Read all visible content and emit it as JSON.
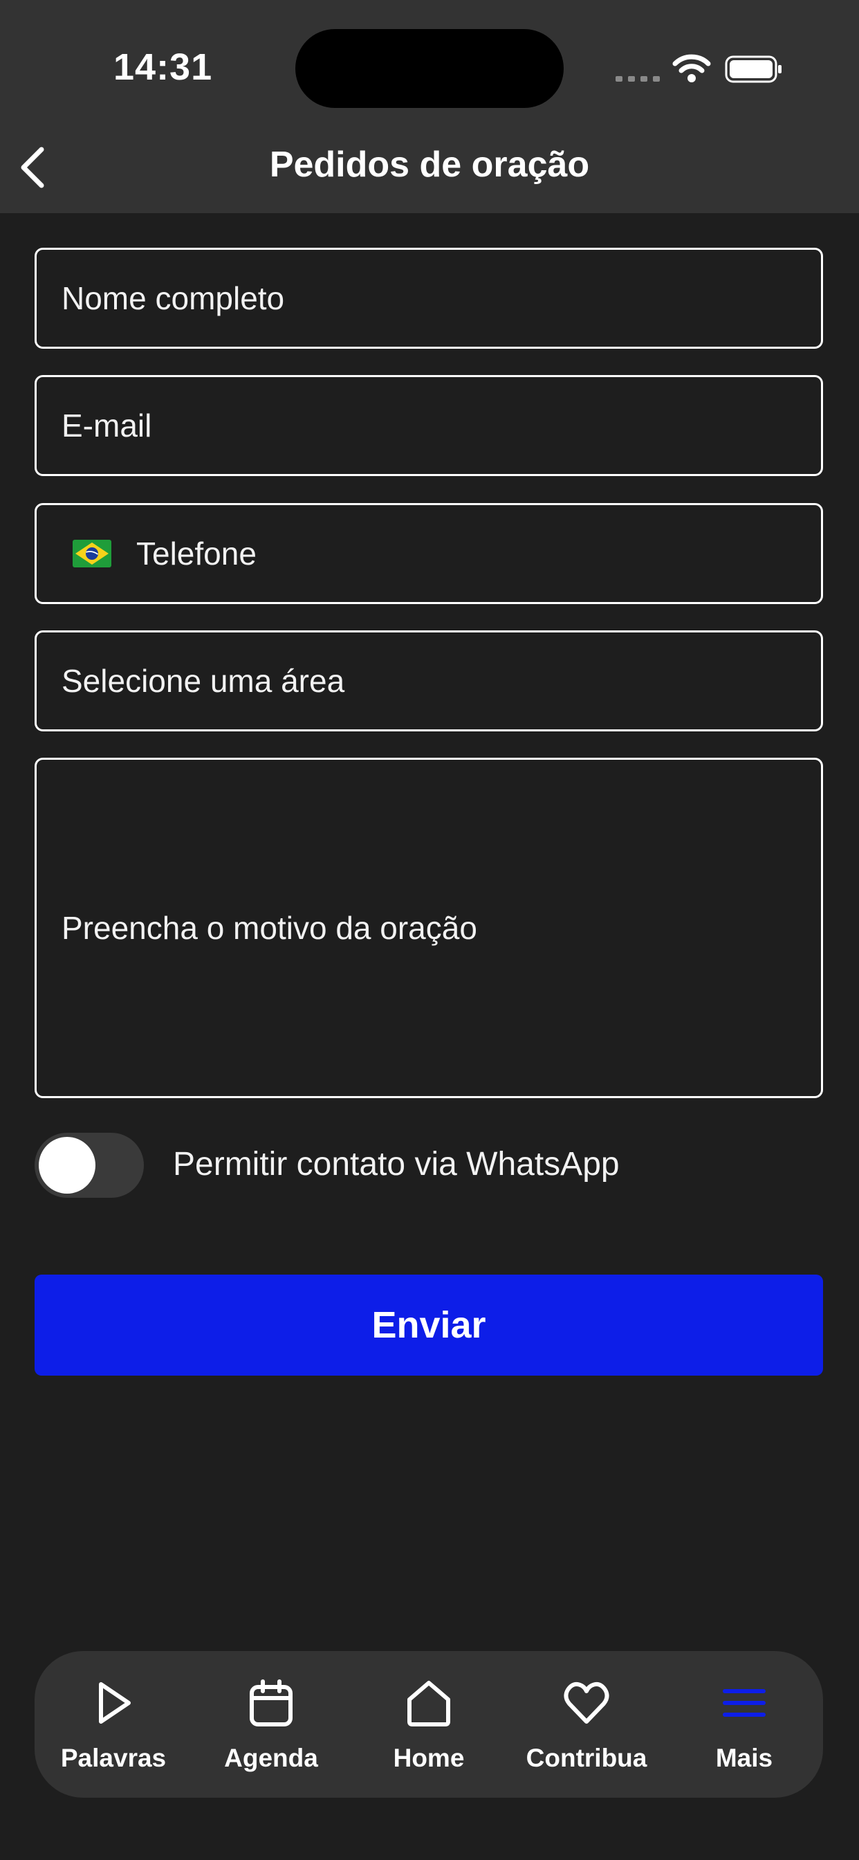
{
  "status_bar": {
    "time": "14:31"
  },
  "nav": {
    "title": "Pedidos de oração"
  },
  "form": {
    "full_name_placeholder": "Nome completo",
    "email_placeholder": "E-mail",
    "phone_placeholder": "Telefone",
    "area_placeholder": "Selecione uma área",
    "reason_placeholder": "Preencha o motivo da oração",
    "whatsapp_toggle_label": "Permitir contato via WhatsApp",
    "whatsapp_toggle_on": false,
    "submit_label": "Enviar"
  },
  "tabbar": {
    "items": [
      {
        "label": "Palavras",
        "icon": "play-icon",
        "active": false
      },
      {
        "label": "Agenda",
        "icon": "calendar-icon",
        "active": false
      },
      {
        "label": "Home",
        "icon": "home-icon",
        "active": false
      },
      {
        "label": "Contribua",
        "icon": "heart-icon",
        "active": false
      },
      {
        "label": "Mais",
        "icon": "menu-icon",
        "active": true
      }
    ]
  },
  "colors": {
    "background": "#1e1e1e",
    "header": "#333333",
    "accent": "#0d1ee8",
    "text": "#ffffff"
  }
}
